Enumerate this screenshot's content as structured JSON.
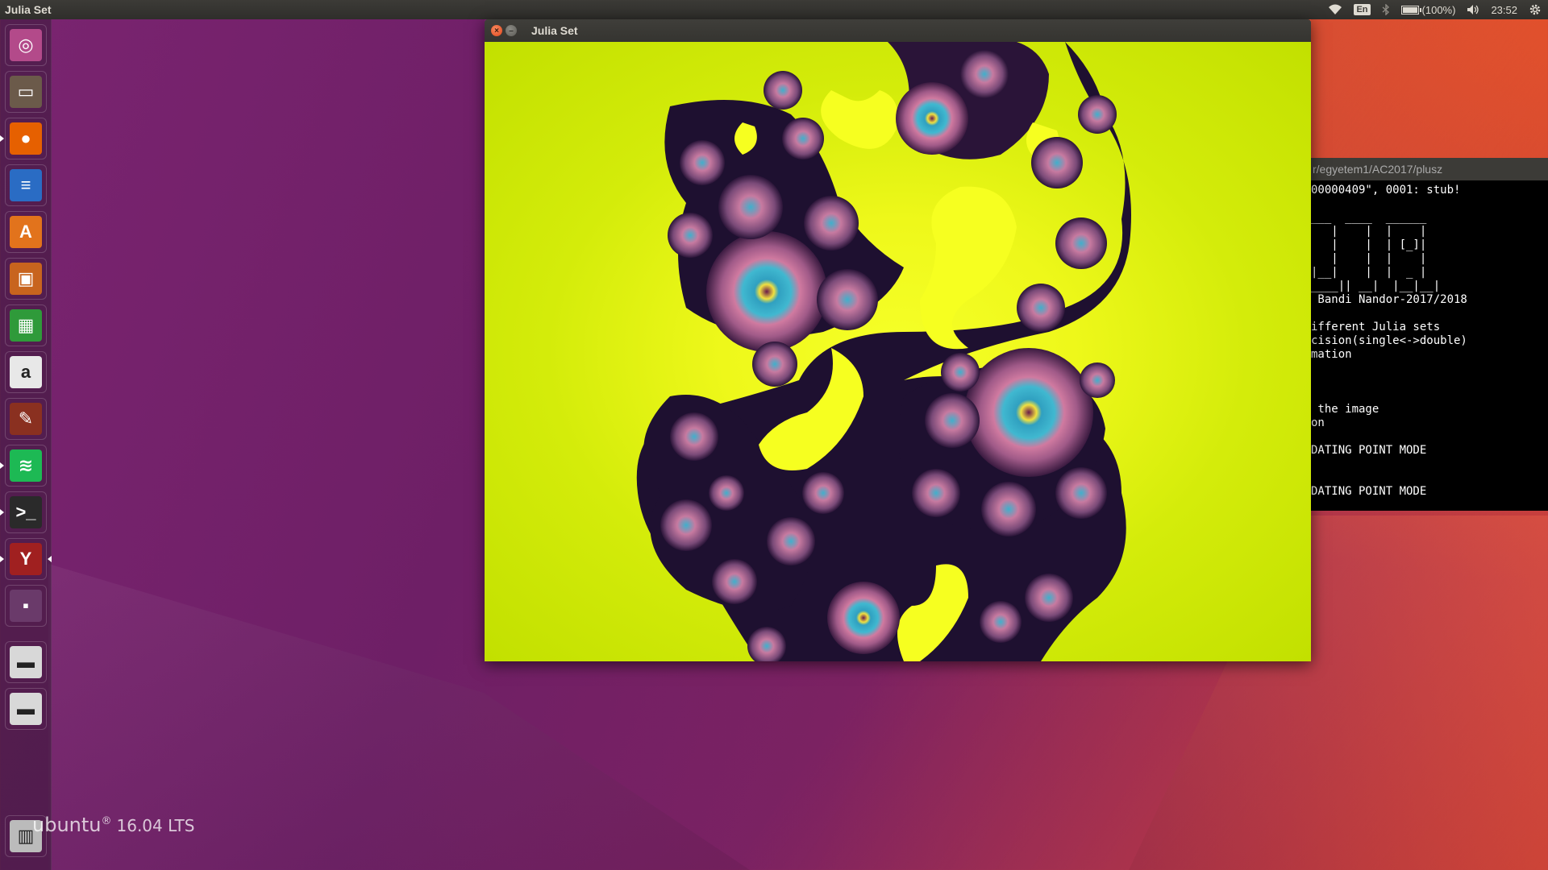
{
  "top_panel": {
    "app_title": "Julia Set",
    "lang": "En",
    "battery": "(100%)",
    "time": "23:52",
    "battery_level": 1.0,
    "icons": [
      "wifi-icon",
      "bluetooth-icon",
      "battery-icon",
      "volume-icon",
      "settings-gear-icon"
    ]
  },
  "launcher": {
    "items": [
      {
        "name": "ubuntu-dash",
        "icon": "ubuntu-logo-icon",
        "color": "#b34a8a"
      },
      {
        "name": "files",
        "icon": "file-manager-icon",
        "color": "#6b5a4a"
      },
      {
        "name": "firefox",
        "icon": "firefox-icon",
        "color": "#e66000"
      },
      {
        "name": "libreoffice-writer",
        "icon": "writer-icon",
        "color": "#2a6cc4"
      },
      {
        "name": "ubuntu-software",
        "icon": "software-center-icon",
        "color": "#e2731c"
      },
      {
        "name": "libreoffice-impress",
        "icon": "impress-icon",
        "color": "#c8641e"
      },
      {
        "name": "libreoffice-calc",
        "icon": "calc-icon",
        "color": "#2f9a3a"
      },
      {
        "name": "amazon",
        "icon": "amazon-icon",
        "color": "#e8e8e8"
      },
      {
        "name": "system-settings",
        "icon": "system-settings-icon",
        "color": "#8a3020"
      },
      {
        "name": "spotify",
        "icon": "spotify-icon",
        "color": "#1db954"
      },
      {
        "name": "terminal",
        "icon": "terminal-icon",
        "color": "#2a2a2a"
      },
      {
        "name": "wine",
        "icon": "wine-glass-icon",
        "color": "#a02020"
      },
      {
        "name": "workspace-switcher",
        "icon": "workspace-switcher-icon",
        "color": "#6a3a6a"
      },
      {
        "name": "drive-1",
        "icon": "drive-icon",
        "color": "#d8d8d8"
      },
      {
        "name": "drive-2",
        "icon": "drive-icon",
        "color": "#d8d8d8"
      },
      {
        "name": "trash",
        "icon": "trash-icon",
        "color": "#bbbbbb"
      }
    ]
  },
  "window": {
    "title": "Julia Set",
    "close_glyph": "×",
    "minimize_glyph": "–"
  },
  "terminal": {
    "title": "r/egyetem1/AC2017/plusz",
    "lines": [
      "00000409\", 0001: stub!",
      "",
      "___  ____  ______",
      "   |    |  |    |",
      "   |    |  | [_]|",
      "   |    |  |    |",
      "|__|    |  |  _ |",
      "____|| __|  |__|__|",
      " Bandi Nandor-2017/2018",
      "",
      "ifferent Julia sets",
      "cision(single<->double)",
      "mation",
      "",
      "",
      "",
      " the image",
      "on",
      "",
      "DATING POINT MODE",
      "",
      "",
      "DATING POINT MODE"
    ]
  },
  "desktop": {
    "ubuntu_brand": "ubuntu",
    "registered": "®",
    "version": "16.04 LTS"
  }
}
